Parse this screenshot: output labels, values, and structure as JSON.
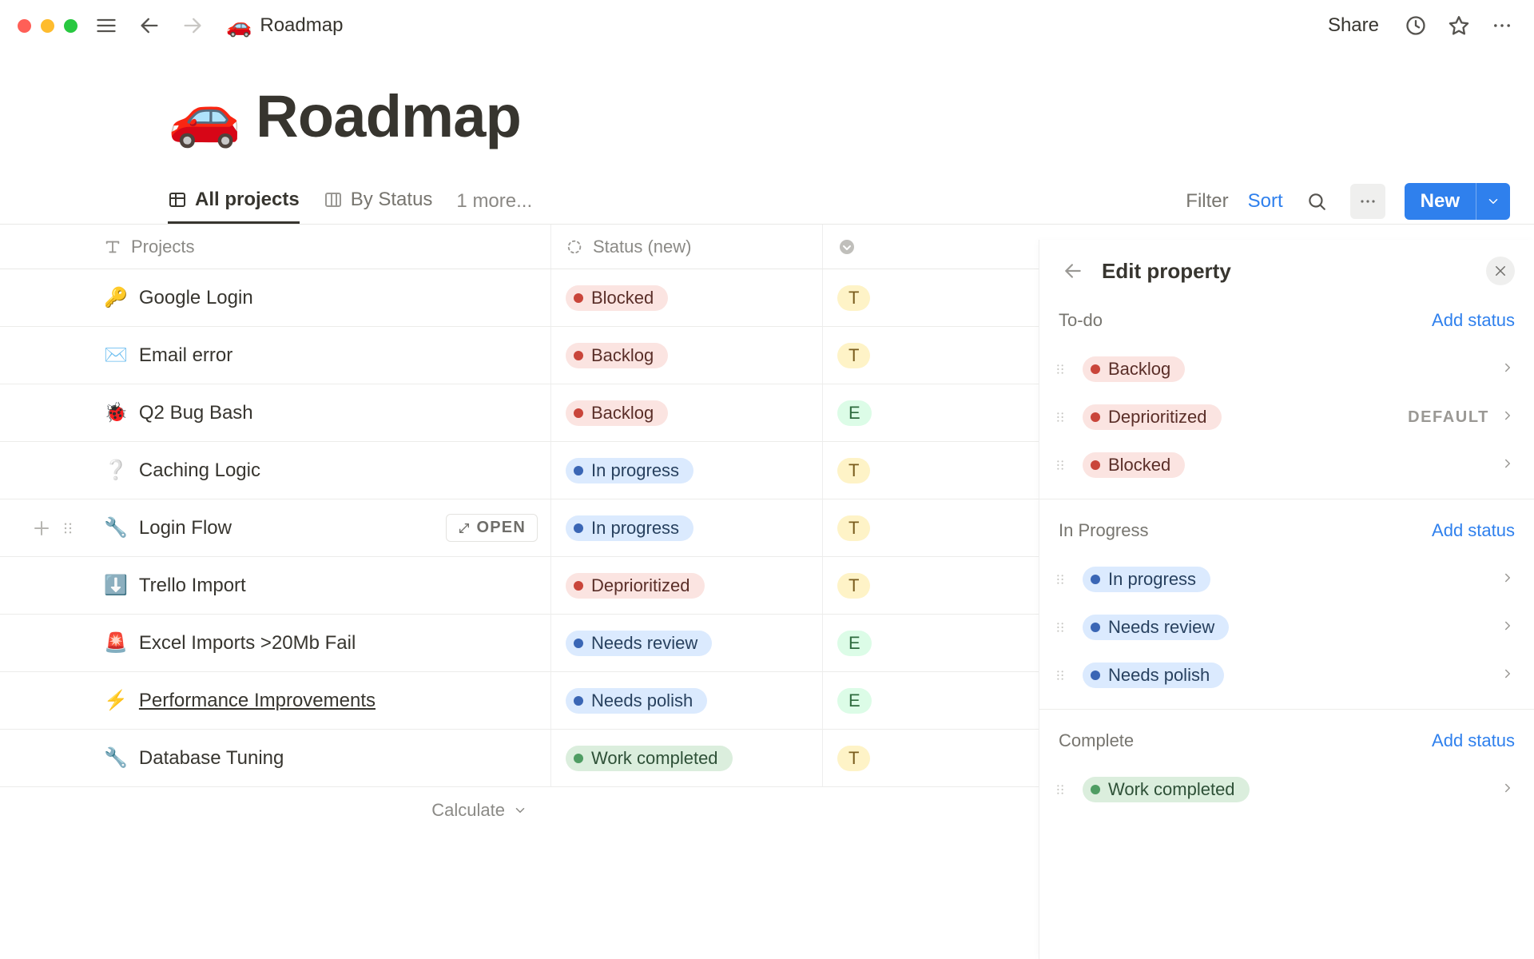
{
  "topbar": {
    "breadcrumb_icon": "🚗",
    "breadcrumb_title": "Roadmap",
    "share_label": "Share"
  },
  "page": {
    "icon": "🚗",
    "title": "Roadmap"
  },
  "views": {
    "tabs": [
      {
        "icon": "table",
        "label": "All projects",
        "active": true
      },
      {
        "icon": "board",
        "label": "By Status",
        "active": false
      }
    ],
    "more_label": "1 more...",
    "filter_label": "Filter",
    "sort_label": "Sort",
    "new_label": "New"
  },
  "table": {
    "columns": {
      "projects": "Projects",
      "status": "Status (new)"
    },
    "rows": [
      {
        "icon": "🔑",
        "name": "Google Login",
        "status": {
          "label": "Blocked",
          "color": "red"
        },
        "owner": "T",
        "owner_color": "yellow"
      },
      {
        "icon": "✉️",
        "name": "Email error",
        "status": {
          "label": "Backlog",
          "color": "red"
        },
        "owner": "T",
        "owner_color": "yellow"
      },
      {
        "icon": "🐞",
        "name": "Q2 Bug Bash",
        "status": {
          "label": "Backlog",
          "color": "red"
        },
        "owner": "E",
        "owner_color": "green"
      },
      {
        "icon": "❔",
        "name": "Caching Logic",
        "status": {
          "label": "In progress",
          "color": "blue"
        },
        "owner": "T",
        "owner_color": "yellow"
      },
      {
        "icon": "🔧",
        "name": "Login Flow",
        "status": {
          "label": "In progress",
          "color": "blue"
        },
        "owner": "T",
        "owner_color": "yellow",
        "hovered": true,
        "open_label": "OPEN"
      },
      {
        "icon": "⬇️",
        "name": "Trello Import",
        "status": {
          "label": "Deprioritized",
          "color": "red"
        },
        "owner": "T",
        "owner_color": "yellow"
      },
      {
        "icon": "🚨",
        "name": "Excel Imports >20Mb Fail",
        "status": {
          "label": "Needs review",
          "color": "blue"
        },
        "owner": "E",
        "owner_color": "green"
      },
      {
        "icon": "⚡",
        "name": "Performance Improvements",
        "status": {
          "label": "Needs polish",
          "color": "blue"
        },
        "owner": "E",
        "owner_color": "green",
        "underline": true
      },
      {
        "icon": "🔧",
        "name": "Database Tuning",
        "status": {
          "label": "Work completed",
          "color": "green"
        },
        "owner": "T",
        "owner_color": "yellow"
      }
    ],
    "calculate_label": "Calculate"
  },
  "side_panel": {
    "title": "Edit property",
    "add_status_label": "Add status",
    "default_label": "DEFAULT",
    "groups": [
      {
        "name": "To-do",
        "items": [
          {
            "label": "Backlog",
            "color": "red"
          },
          {
            "label": "Deprioritized",
            "color": "red",
            "is_default": true
          },
          {
            "label": "Blocked",
            "color": "red"
          }
        ]
      },
      {
        "name": "In Progress",
        "items": [
          {
            "label": "In progress",
            "color": "blue"
          },
          {
            "label": "Needs review",
            "color": "blue"
          },
          {
            "label": "Needs polish",
            "color": "blue"
          }
        ]
      },
      {
        "name": "Complete",
        "items": [
          {
            "label": "Work completed",
            "color": "green"
          }
        ]
      }
    ]
  }
}
